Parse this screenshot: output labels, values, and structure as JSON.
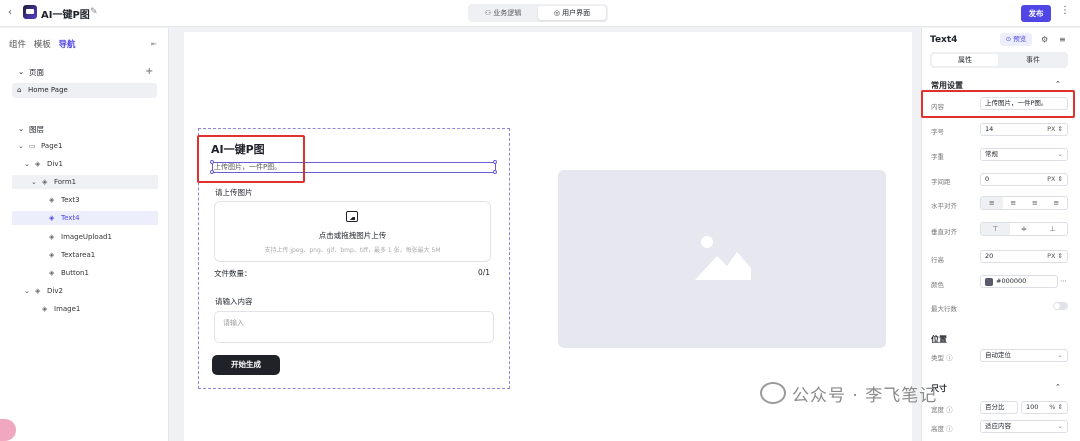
{
  "topbar": {
    "back_icon": "chevron-left-icon",
    "title": "AI一键P图",
    "tab_logic": "业务逻辑",
    "tab_ui": "用户界面",
    "publish": "发布",
    "logic_icon": "flow-icon",
    "ui_icon": "palette-icon"
  },
  "left": {
    "tabs": [
      "组件",
      "模板",
      "导航"
    ],
    "pages_label": "页面",
    "home_page": "Home Page",
    "layers_label": "图层",
    "tree": [
      {
        "label": "Page1"
      },
      {
        "label": "Div1"
      },
      {
        "label": "Form1"
      },
      {
        "label": "Text3"
      },
      {
        "label": "Text4"
      },
      {
        "label": "ImageUpload1"
      },
      {
        "label": "Textarea1"
      },
      {
        "label": "Button1"
      },
      {
        "label": "Div2"
      },
      {
        "label": "Image1"
      }
    ]
  },
  "canvas": {
    "heading": "AI一键P图",
    "subtitle": "上传图片，一件P图。",
    "upload_label": "请上传图片",
    "upload_title": "点击或拖拽图片上传",
    "upload_hint": "支持上传 jpeg、png、gif、bmp、tiff，最多 1 张，每张最大 5M",
    "file_count_label": "文件数量：",
    "file_count": "0/1",
    "textarea_label": "请输入内容",
    "textarea_placeholder": "请输入",
    "button": "开始生成"
  },
  "right": {
    "title": "Text4",
    "preview": "预览",
    "tab_props": "属性",
    "tab_events": "事件",
    "common_settings": "常用设置",
    "content_label": "内容",
    "content_value": "上传图片，一件P图。",
    "font_size_label": "字号",
    "font_size_value": "14",
    "px": "PX",
    "weight_label": "字重",
    "weight_value": "常规",
    "spacing_label": "字间距",
    "spacing_value": "0",
    "h_align_label": "水平对齐",
    "v_align_label": "垂直对齐",
    "line_height_label": "行高",
    "line_height_value": "20",
    "color_label": "颜色",
    "color_value": "#000000",
    "max_lines_label": "最大行数",
    "position_label": "位置",
    "type_label": "类型",
    "type_value": "自动定位",
    "size_label": "尺寸",
    "width_label": "宽度",
    "width_mode": "百分比",
    "width_value": "100",
    "percent": "%",
    "height_label": "高度",
    "height_value": "适应内容"
  },
  "watermark": "公众号 · 李飞笔记",
  "colors": {
    "accent": "#4f46e5",
    "highlight": "#e0312d",
    "text_color": "#000000"
  }
}
